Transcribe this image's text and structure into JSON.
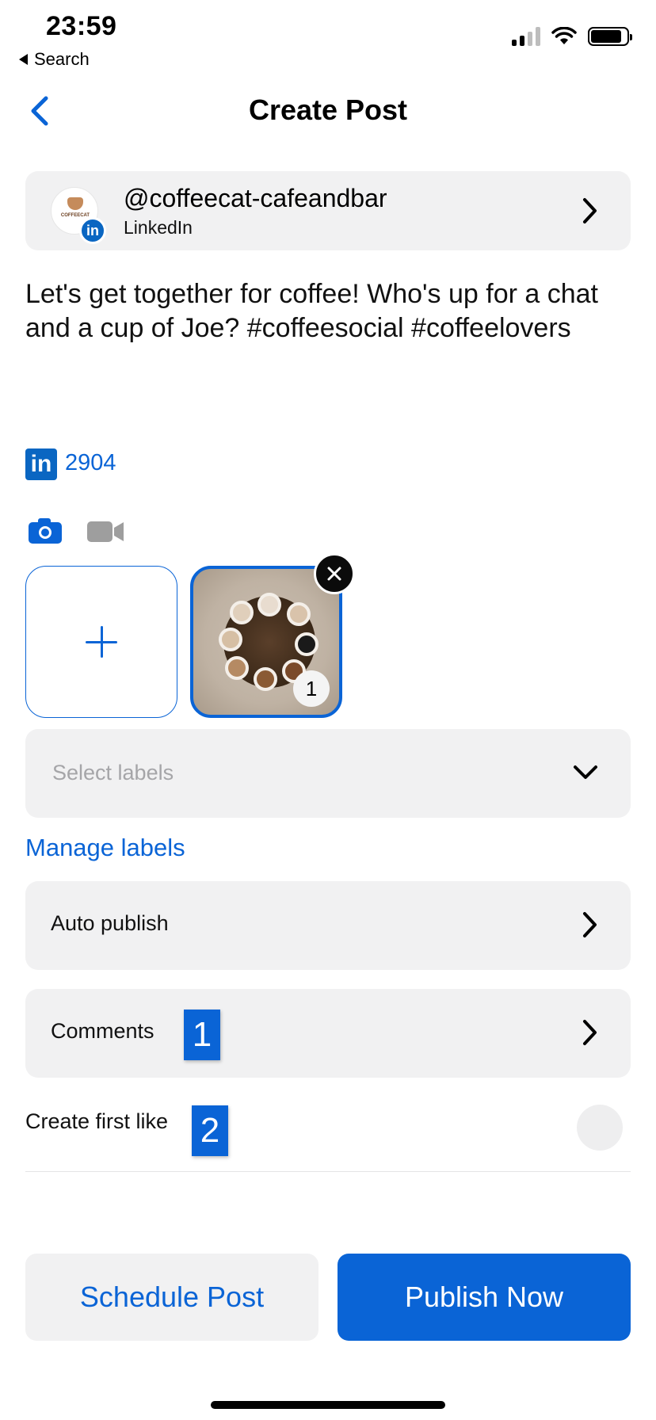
{
  "status_bar": {
    "time": "23:59",
    "back_app": "Search",
    "signal_icon": "signal-icon",
    "wifi_icon": "wifi-icon",
    "battery_icon": "battery-icon"
  },
  "nav": {
    "title": "Create Post",
    "back_icon": "chevron-left-icon"
  },
  "account": {
    "handle": "@coffeecat-cafeandbar",
    "network": "LinkedIn",
    "avatar_text": "COFFEECAT",
    "network_badge": "in"
  },
  "post": {
    "text": "Let's get together for coffee! Who's up for a chat and a cup of Joe? #coffeesocial #coffeelovers"
  },
  "linkedin": {
    "icon_text": "in",
    "count": "2904"
  },
  "media": {
    "camera_icon": "camera-icon",
    "video_icon": "video-icon",
    "photo_index": "1"
  },
  "labels": {
    "placeholder": "Select labels",
    "manage": "Manage labels"
  },
  "rows": {
    "auto_publish": "Auto publish",
    "comments": "Comments",
    "comments_badge": "1",
    "first_like": "Create first like",
    "first_like_badge": "2"
  },
  "buttons": {
    "schedule": "Schedule Post",
    "publish": "Publish Now"
  },
  "colors": {
    "accent": "#0a64d6",
    "linkedin": "#0a66c2",
    "card_bg": "#f1f1f2"
  }
}
